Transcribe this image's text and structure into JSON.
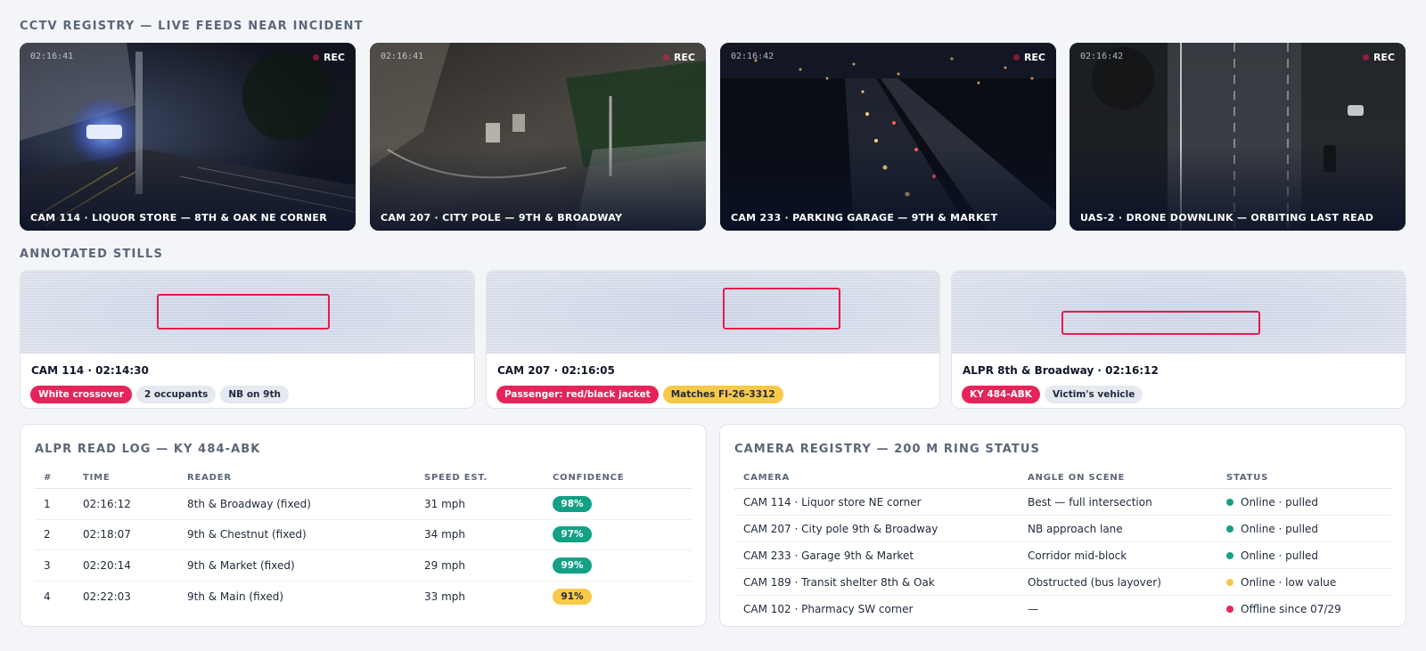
{
  "sections": {
    "feeds_title": "CCTV REGISTRY — LIVE FEEDS NEAR INCIDENT",
    "stills_title": "ANNOTATED STILLS"
  },
  "feeds": [
    {
      "timecode": "02:16:41",
      "rec": "REC",
      "caption": "CAM 114 · LIQUOR STORE — 8TH & OAK NE CORNER"
    },
    {
      "timecode": "02:16:41",
      "rec": "REC",
      "caption": "CAM 207 · CITY POLE — 9TH & BROADWAY"
    },
    {
      "timecode": "02:16:42",
      "rec": "REC",
      "caption": "CAM 233 · PARKING GARAGE — 9TH & MARKET"
    },
    {
      "timecode": "02:16:42",
      "rec": "REC",
      "caption": "UAS-2 · DRONE DOWNLINK — ORBITING LAST READ"
    }
  ],
  "stills": [
    {
      "title": "CAM 114 · 02:14:30",
      "tags": [
        {
          "label": "White crossover",
          "color": "#e6245a"
        },
        {
          "label": "2 occupants",
          "color": "#e6e9ef"
        },
        {
          "label": "NB on 9th",
          "color": "#e6e9ef"
        }
      ]
    },
    {
      "title": "CAM 207 · 02:16:05",
      "tags": [
        {
          "label": "Passenger: red/black jacket",
          "color": "#e6245a"
        },
        {
          "label": "Matches FI-26-3312",
          "color": "#f7c948"
        }
      ]
    },
    {
      "title": "ALPR 8th & Broadway · 02:16:12",
      "tags": [
        {
          "label": "KY 484-ABK",
          "color": "#e6245a"
        },
        {
          "label": "Victim's vehicle",
          "color": "#e6e9ef"
        }
      ]
    }
  ],
  "alpr": {
    "title": "ALPR READ LOG — KY 484-ABK",
    "headers": [
      "#",
      "TIME",
      "READER",
      "SPEED EST.",
      "CONFIDENCE"
    ],
    "rows": [
      {
        "n": "1",
        "time": "02:16:12",
        "reader": "8th & Broadway (fixed)",
        "speed": "31 mph",
        "confidence": "98%"
      },
      {
        "n": "2",
        "time": "02:18:07",
        "reader": "9th & Chestnut (fixed)",
        "speed": "34 mph",
        "confidence": "97%"
      },
      {
        "n": "3",
        "time": "02:20:14",
        "reader": "9th & Market (fixed)",
        "speed": "29 mph",
        "confidence": "99%"
      },
      {
        "n": "4",
        "time": "02:22:03",
        "reader": "9th & Main (fixed)",
        "speed": "33 mph",
        "confidence": "91%"
      }
    ]
  },
  "registry": {
    "title": "CAMERA REGISTRY — 200 M RING STATUS",
    "headers": [
      "CAMERA",
      "ANGLE ON SCENE",
      "STATUS"
    ],
    "rows": [
      {
        "camera": "CAM 114 · Liquor store NE corner",
        "angle": "Best — full intersection",
        "status": "Online · pulled",
        "status_color": "#14a085"
      },
      {
        "camera": "CAM 207 · City pole 9th & Broadway",
        "angle": "NB approach lane",
        "status": "Online · pulled",
        "status_color": "#14a085"
      },
      {
        "camera": "CAM 233 · Garage 9th & Market",
        "angle": "Corridor mid-block",
        "status": "Online · pulled",
        "status_color": "#14a085"
      },
      {
        "camera": "CAM 189 · Transit shelter 8th & Oak",
        "angle": "Obstructed (bus layover)",
        "status": "Online · low value",
        "status_color": "#f7c948"
      },
      {
        "camera": "CAM 102 · Pharmacy SW corner",
        "angle": "—",
        "status": "Offline since 07/29",
        "status_color": "#e6245a"
      }
    ]
  },
  "colors": {
    "alert": "#e6245a",
    "ok": "#14a085",
    "warn": "#f7c948",
    "muted": "#5b6678"
  }
}
